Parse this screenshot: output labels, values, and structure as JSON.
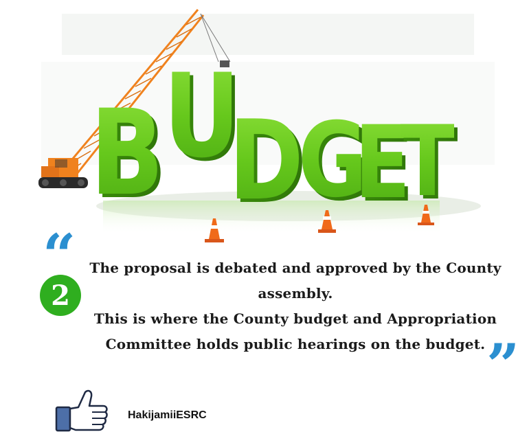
{
  "hero": {
    "word": "BUDGET"
  },
  "quote": {
    "open_mark": "“",
    "close_mark": "”",
    "step_number": "2",
    "lines": [
      "The proposal is debated and approved by the County",
      "assembly.",
      "This is where the County budget and Appropriation",
      "Committee holds public hearings on the budget."
    ]
  },
  "footer": {
    "brand": "HakijamiiESRC",
    "icon": "thumbs-up-icon"
  },
  "colors": {
    "budget_green": "#67c81d",
    "budget_green_dark": "#3f8f0d",
    "quote_blue": "#2b8fd0",
    "badge_green": "#2fae1f",
    "crane_orange": "#f0821e",
    "cone_orange": "#f06a1a",
    "thumb_blue": "#4d6fa8"
  }
}
